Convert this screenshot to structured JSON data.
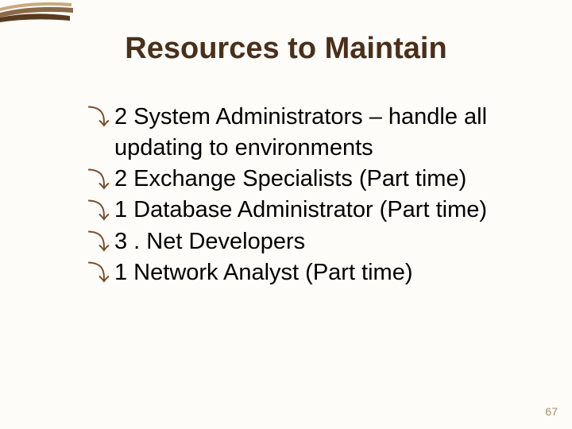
{
  "title": "Resources to Maintain",
  "bullet_glyph": "⤵",
  "items": [
    "2 System Administrators – handle all updating to environments",
    "2 Exchange Specialists (Part time)",
    "1 Database Administrator (Part time)",
    "3 . Net Developers",
    "1 Network Analyst (Part time)"
  ],
  "page_number": "67"
}
